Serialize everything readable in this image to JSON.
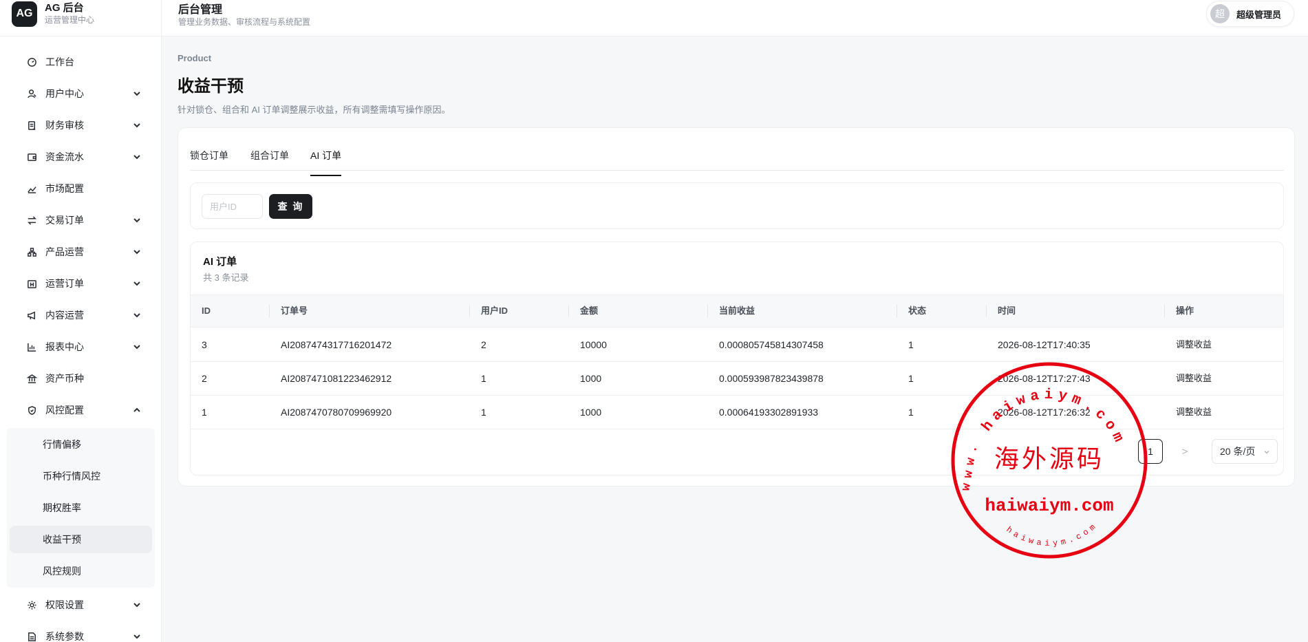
{
  "brand": {
    "logo": "AG",
    "title": "AG 后台",
    "subtitle": "运营管理中心"
  },
  "header": {
    "title": "后台管理",
    "subtitle": "管理业务数据、审核流程与系统配置"
  },
  "user": {
    "avatar": "超",
    "name": "超级管理员"
  },
  "sidebar": {
    "items": [
      {
        "label": "工作台",
        "icon": "dashboard-icon",
        "expandable": false
      },
      {
        "label": "用户中心",
        "icon": "user-icon",
        "expandable": true
      },
      {
        "label": "财务审核",
        "icon": "document-icon",
        "expandable": true
      },
      {
        "label": "资金流水",
        "icon": "wallet-icon",
        "expandable": true
      },
      {
        "label": "市场配置",
        "icon": "trend-icon",
        "expandable": false
      },
      {
        "label": "交易订单",
        "icon": "swap-icon",
        "expandable": true
      },
      {
        "label": "产品运营",
        "icon": "cubes-icon",
        "expandable": true
      },
      {
        "label": "运营订单",
        "icon": "calendar-icon",
        "expandable": true
      },
      {
        "label": "内容运营",
        "icon": "megaphone-icon",
        "expandable": true
      },
      {
        "label": "报表中心",
        "icon": "bar-chart-icon",
        "expandable": true
      },
      {
        "label": "资产币种",
        "icon": "bank-icon",
        "expandable": false
      },
      {
        "label": "风控配置",
        "icon": "shield-icon",
        "expandable": true,
        "expanded": true
      },
      {
        "label": "权限设置",
        "icon": "gear-icon",
        "expandable": true
      },
      {
        "label": "系统参数",
        "icon": "file-icon",
        "expandable": true
      }
    ],
    "submenu": [
      {
        "label": "行情偏移"
      },
      {
        "label": "币种行情风控"
      },
      {
        "label": "期权胜率"
      },
      {
        "label": "收益干预",
        "active": true
      },
      {
        "label": "风控规则"
      }
    ]
  },
  "page": {
    "eyebrow": "Product",
    "title": "收益干预",
    "description": "针对锁仓、组合和 AI 订单调整展示收益，所有调整需填写操作原因。"
  },
  "tabs": [
    {
      "label": "锁仓订单",
      "active": false
    },
    {
      "label": "组合订单",
      "active": false
    },
    {
      "label": "AI 订单",
      "active": true
    }
  ],
  "filter": {
    "placeholder": "用户ID",
    "value": "",
    "query_label": "查 询"
  },
  "table": {
    "title": "AI 订单",
    "count_text": "共 3 条记录",
    "columns": [
      "ID",
      "订单号",
      "用户ID",
      "金额",
      "当前收益",
      "状态",
      "时间",
      "操作"
    ],
    "rows": [
      {
        "id": "3",
        "order_no": "AI2087474317716201472",
        "user_id": "2",
        "amount": "10000",
        "profit": "0.000805745814307458",
        "status": "1",
        "time": "2026-08-12T17:40:35",
        "action": "调整收益"
      },
      {
        "id": "2",
        "order_no": "AI2087471081223462912",
        "user_id": "1",
        "amount": "1000",
        "profit": "0.000593987823439878",
        "status": "1",
        "time": "2026-08-12T17:27:43",
        "action": "调整收益"
      },
      {
        "id": "1",
        "order_no": "AI2087470780709969920",
        "user_id": "1",
        "amount": "1000",
        "profit": "0.00064193302891933",
        "status": "1",
        "time": "2026-08-12T17:26:32",
        "action": "调整收益"
      }
    ]
  },
  "pagination": {
    "current_page": "1",
    "page_size": "20 条/页",
    "prev": "<",
    "next": ">"
  },
  "watermark": {
    "top_arc": "haiwaiym.com",
    "side_text": "www.",
    "center": "海外源码",
    "domain": "haiwaiym.com",
    "bottom_arc": "haiwaiym.com",
    "color": "#e60012"
  },
  "colors": {
    "primary": "#1c1e22",
    "muted": "#8a919c",
    "active_bg": "#eceef2"
  }
}
